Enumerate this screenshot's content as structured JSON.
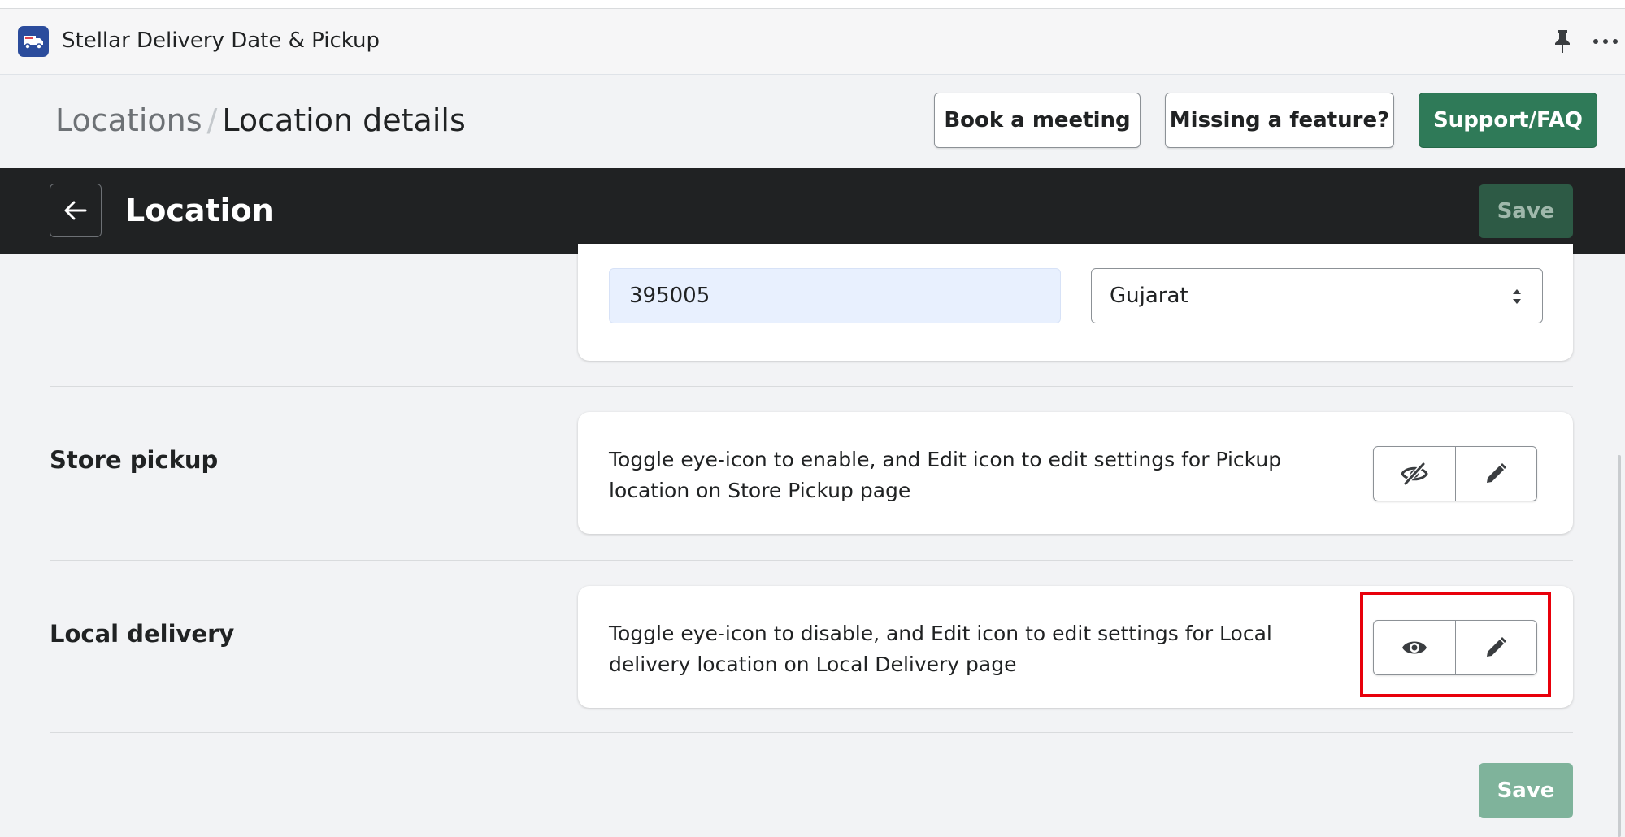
{
  "app": {
    "title": "Stellar Delivery Date & Pickup",
    "logo_icon": "delivery-truck-icon",
    "pin_icon": "pin-icon",
    "more_icon": "more-horizontal-icon"
  },
  "header": {
    "breadcrumb_parent": "Locations",
    "breadcrumb_separator": "/",
    "breadcrumb_current": "Location details",
    "book_meeting_label": "Book a meeting",
    "missing_feature_label": "Missing a feature?",
    "support_label": "Support/FAQ"
  },
  "save_bar": {
    "back_icon": "arrow-left-icon",
    "title": "Location",
    "save_label": "Save"
  },
  "address": {
    "zip_value": "395005",
    "state_value": "Gujarat"
  },
  "store_pickup": {
    "label": "Store pickup",
    "description": "Toggle eye-icon to enable, and Edit icon to edit settings for Pickup location on Store Pickup page",
    "visibility_icon": "eye-off-icon",
    "edit_icon": "pencil-icon"
  },
  "local_delivery": {
    "label": "Local delivery",
    "description": "Toggle eye-icon to disable, and Edit icon to edit settings for Local delivery location on Local Delivery page",
    "visibility_icon": "eye-icon",
    "edit_icon": "pencil-icon"
  },
  "footer": {
    "save_label": "Save"
  },
  "colors": {
    "primary_green": "#2f7a58",
    "save_bar_bg": "#202223",
    "highlight": "#e8000b"
  }
}
